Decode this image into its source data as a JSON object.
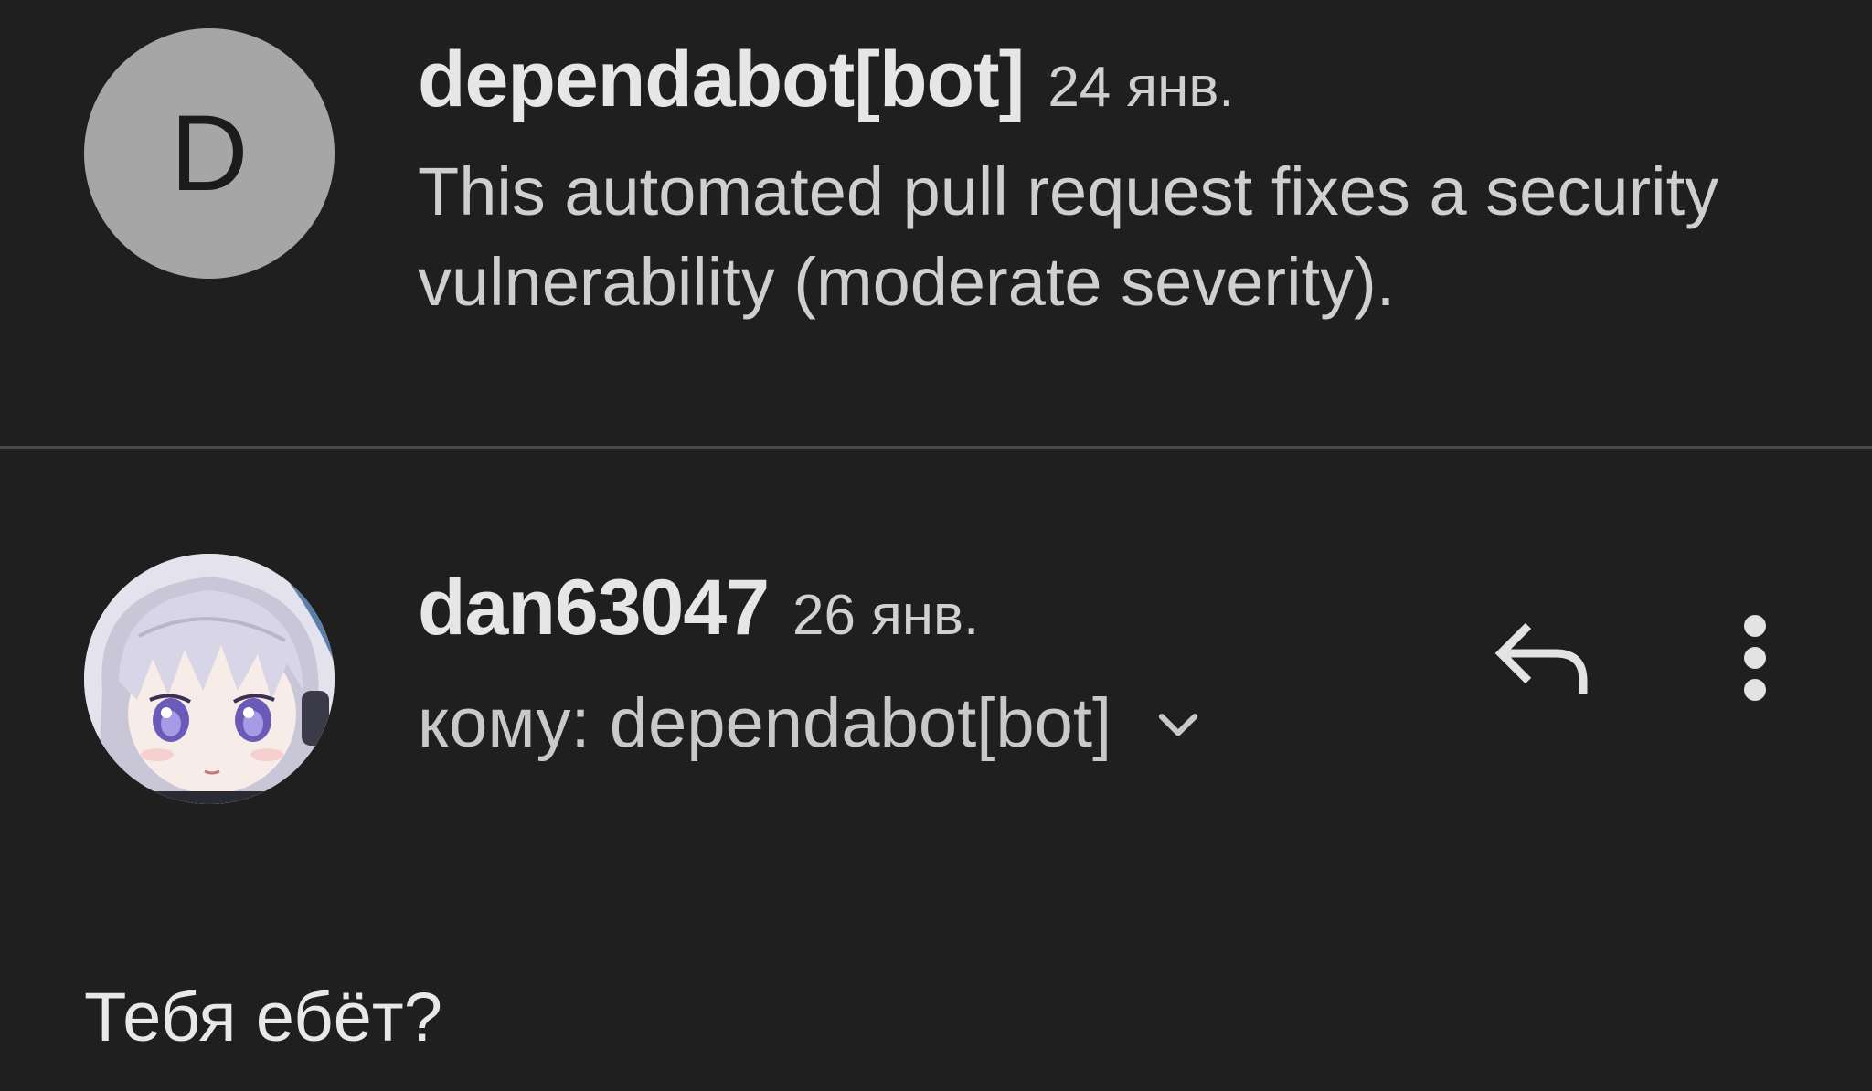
{
  "messages": [
    {
      "avatar_letter": "D",
      "sender": "dependabot[bot]",
      "date": "24 янв.",
      "snippet": "This automated pull request fixes a security vulnerability (moderate severity)."
    },
    {
      "avatar": "anime-avatar-image",
      "sender": "dan63047",
      "date": "26 янв.",
      "recipient": "кому: dependabot[bot]",
      "body": "Тебя ебёт?"
    }
  ],
  "icons": {
    "reply": "reply-icon",
    "more": "more-vert-icon",
    "expand": "chevron-down-icon"
  },
  "colors": {
    "background": "#1f1f1f",
    "avatar_letter_bg": "#a6a6a6",
    "divider": "#4a4a4a"
  }
}
